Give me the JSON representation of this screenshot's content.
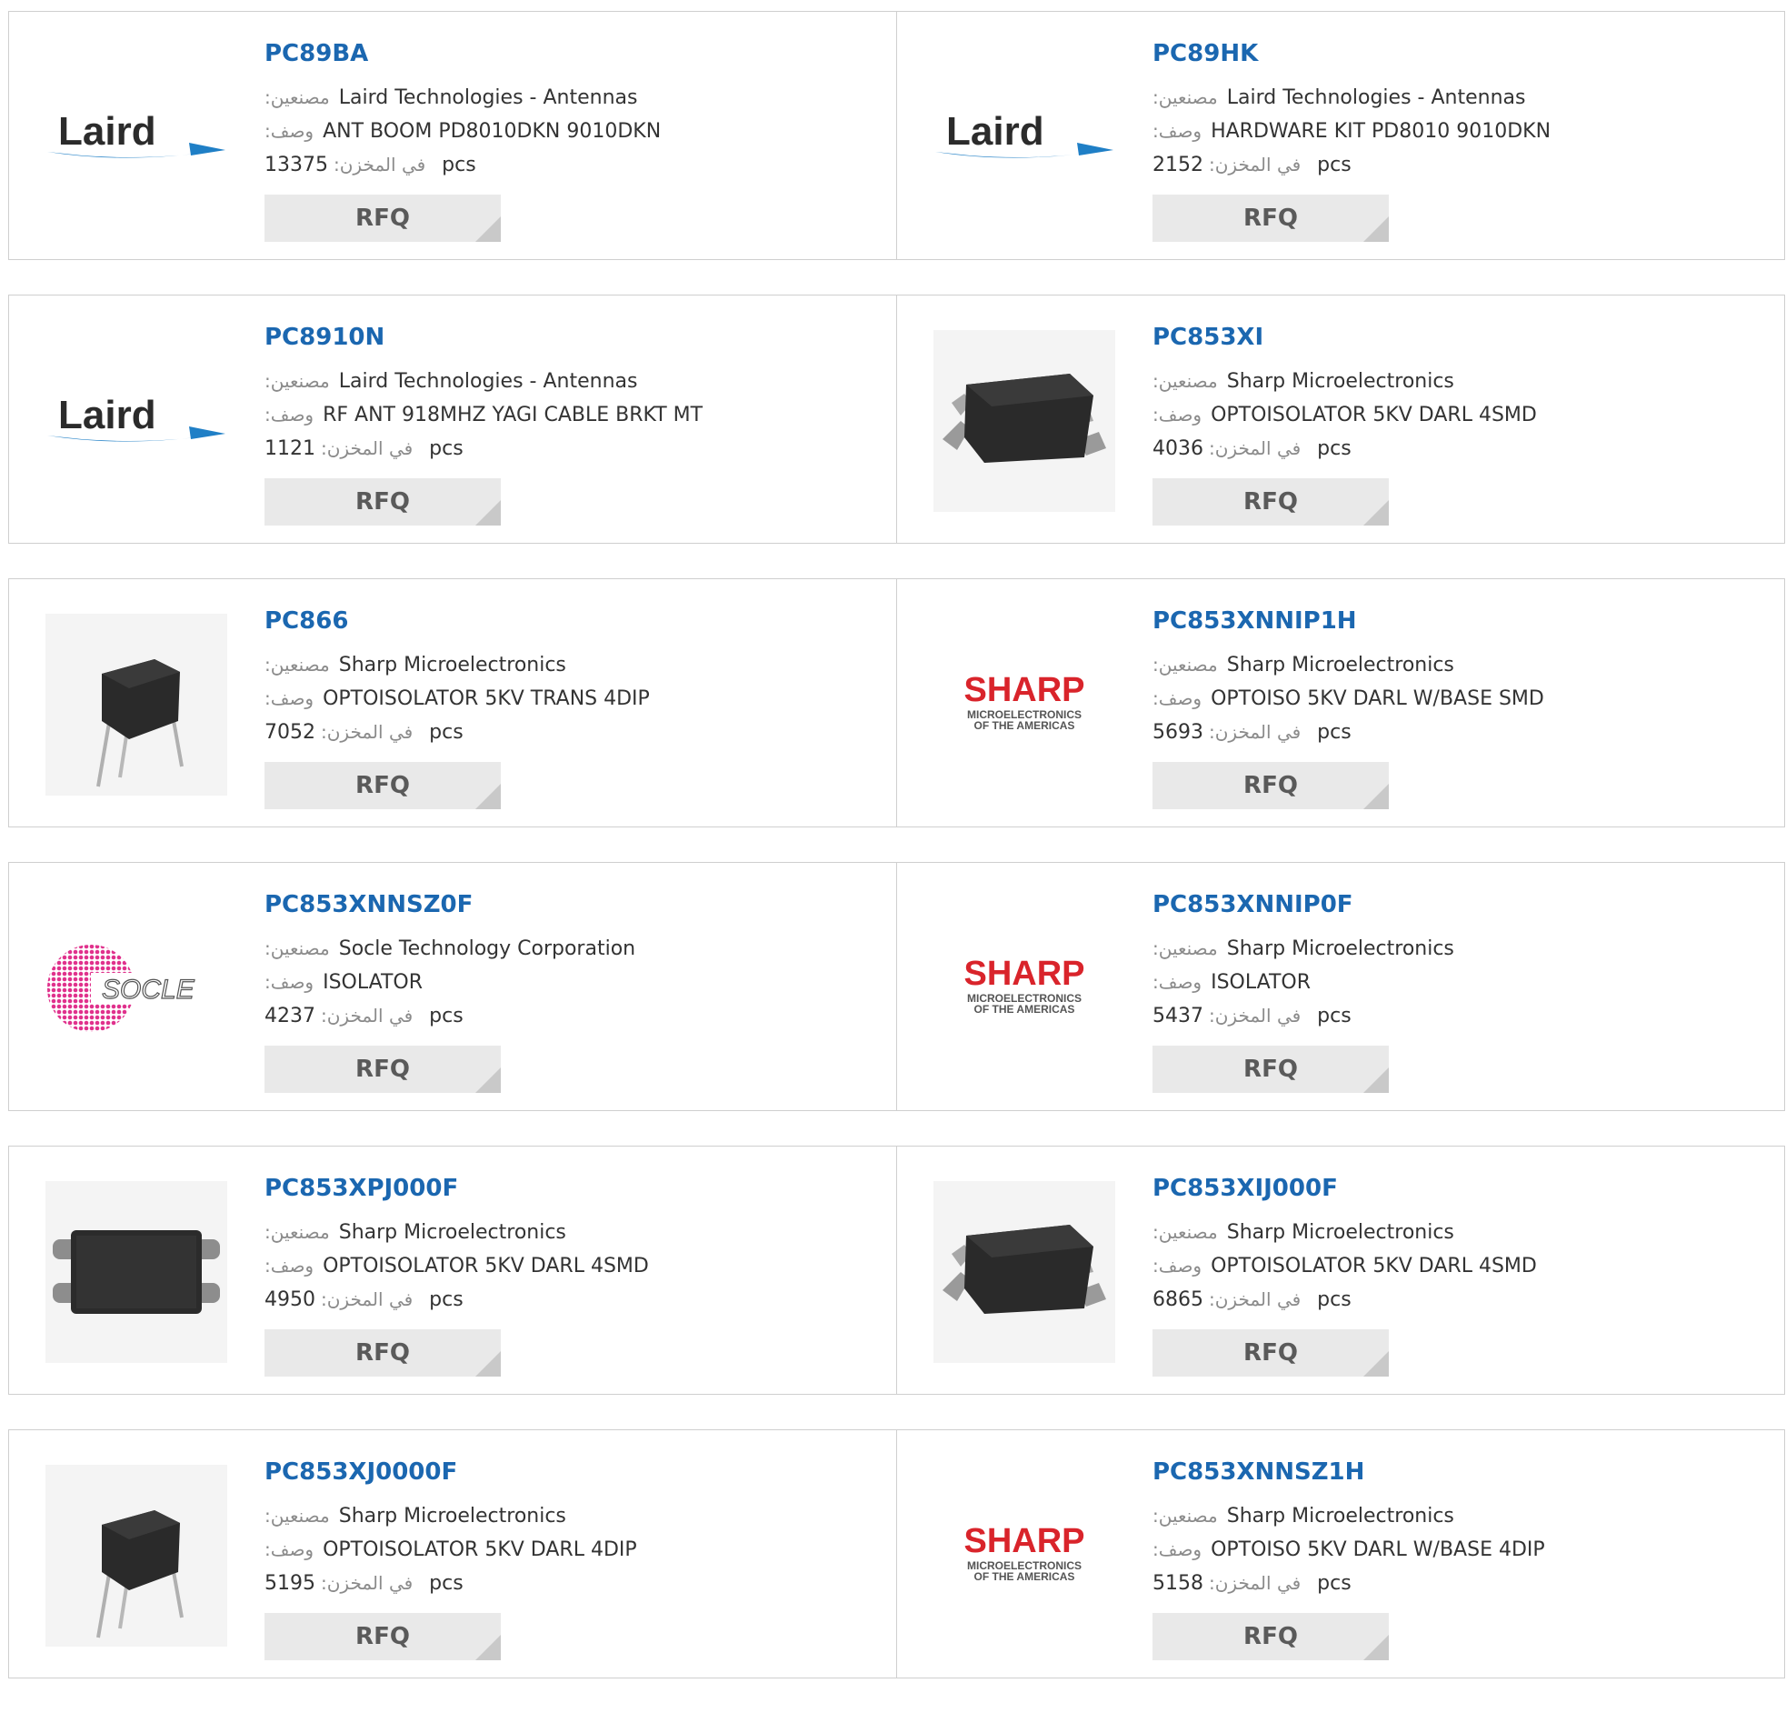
{
  "labels": {
    "manufacturer": "مصنعين:",
    "description": "وصف:",
    "stock": "في المخزن:",
    "unit": "pcs",
    "rfq": "RFQ"
  },
  "brands": {
    "laird": "Laird",
    "sharp": "SHARP",
    "sharp_sub1": "MICROELECTRONICS",
    "sharp_sub2": "OF THE AMERICAS",
    "socle": "SOCLE"
  },
  "colors": {
    "part_number": "#1b67b0",
    "sharp_red": "#d9242b",
    "laird_blue": "#1f7fc6",
    "socle_pink": "#e0318c",
    "button_bg": "#e9e9e9"
  },
  "products": [
    {
      "part": "PC89BA",
      "manufacturer": "Laird Technologies - Antennas",
      "description": "ANT BOOM PD8010DKN 9010DKN",
      "stock": "13375",
      "image": "laird-logo"
    },
    {
      "part": "PC89HK",
      "manufacturer": "Laird Technologies - Antennas",
      "description": "HARDWARE KIT PD8010 9010DKN",
      "stock": "2152",
      "image": "laird-logo"
    },
    {
      "part": "PC8910N",
      "manufacturer": "Laird Technologies - Antennas",
      "description": "RF ANT 918MHZ YAGI CABLE BRKT MT",
      "stock": "1121",
      "image": "laird-logo"
    },
    {
      "part": "PC853XI",
      "manufacturer": "Sharp Microelectronics",
      "description": "OPTOISOLATOR 5KV DARL 4SMD",
      "stock": "4036",
      "image": "smd-chip-photo"
    },
    {
      "part": "PC866",
      "manufacturer": "Sharp Microelectronics",
      "description": "OPTOISOLATOR 5KV TRANS 4DIP",
      "stock": "7052",
      "image": "dip-chip-photo"
    },
    {
      "part": "PC853XNNIP1H",
      "manufacturer": "Sharp Microelectronics",
      "description": "OPTOISO 5KV DARL W/BASE SMD",
      "stock": "5693",
      "image": "sharp-logo"
    },
    {
      "part": "PC853XNNSZ0F",
      "manufacturer": "Socle Technology Corporation",
      "description": "ISOLATOR",
      "stock": "4237",
      "image": "socle-logo"
    },
    {
      "part": "PC853XNNIP0F",
      "manufacturer": "Sharp Microelectronics",
      "description": "ISOLATOR",
      "stock": "5437",
      "image": "sharp-logo"
    },
    {
      "part": "PC853XPJ000F",
      "manufacturer": "Sharp Microelectronics",
      "description": "OPTOISOLATOR 5KV DARL 4SMD",
      "stock": "4950",
      "image": "smd-flat-chip-photo"
    },
    {
      "part": "PC853XIJ000F",
      "manufacturer": "Sharp Microelectronics",
      "description": "OPTOISOLATOR 5KV DARL 4SMD",
      "stock": "6865",
      "image": "smd-chip-photo"
    },
    {
      "part": "PC853XJ0000F",
      "manufacturer": "Sharp Microelectronics",
      "description": "OPTOISOLATOR 5KV DARL 4DIP",
      "stock": "5195",
      "image": "dip-chip-photo"
    },
    {
      "part": "PC853XNNSZ1H",
      "manufacturer": "Sharp Microelectronics",
      "description": "OPTOISO 5KV DARL W/BASE 4DIP",
      "stock": "5158",
      "image": "sharp-logo"
    }
  ]
}
